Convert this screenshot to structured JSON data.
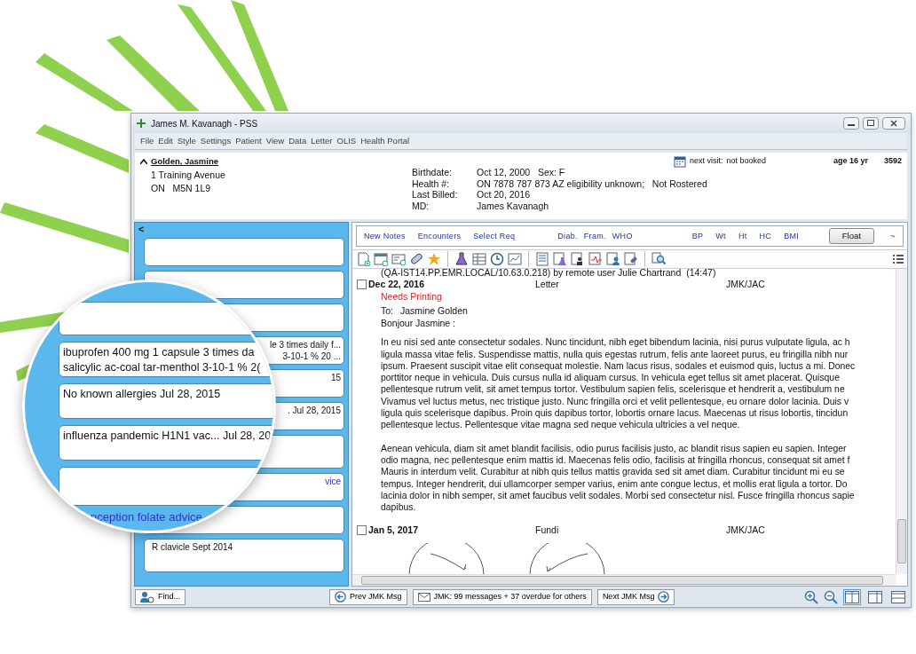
{
  "window": {
    "title": "James M. Kavanagh - PSS"
  },
  "menu": [
    "File",
    "Edit",
    "Style",
    "Settings",
    "Patient",
    "View",
    "Data",
    "Letter",
    "OLIS",
    "Health Portal"
  ],
  "patient": {
    "name": "Golden, Jasmine",
    "address": [
      "1 Training Avenue",
      "ON   M5N 1L9"
    ],
    "fields": [
      {
        "label": "Birthdate:",
        "value": "Oct 12, 2000   Sex: F"
      },
      {
        "label": "Health #:",
        "value": "ON 7878 787 873 AZ eligibility unknown;   Not Rostered"
      },
      {
        "label": "Last Billed:",
        "value": "Oct 20, 2016"
      },
      {
        "label": "MD:",
        "value": "James Kavanagh"
      }
    ],
    "next_visit_label": "next visit:",
    "next_visit": "not booked",
    "age": "age 16 yr",
    "chart_number": "3592"
  },
  "quick_links": [
    "New Notes",
    "Encounters",
    "Select Req",
    "Diab.",
    "Fram.",
    "WHO",
    "BP",
    "Wt",
    "Ht",
    "HC",
    "BMI"
  ],
  "float_button": "Float",
  "trend_symbol": "~",
  "sidebar": {
    "collapse": "<",
    "cards": [
      {
        "kind": "empty"
      },
      {
        "kind": "empty"
      },
      {
        "kind": "empty"
      },
      {
        "kind": "text",
        "lines": [
          "le 3 times daily f...",
          "3-10-1 % 20 ..."
        ]
      },
      {
        "kind": "text",
        "lines": [
          "15"
        ]
      },
      {
        "kind": "text",
        "lines": [
          ". Jul 28, 2015"
        ]
      },
      {
        "kind": "empty"
      },
      {
        "kind": "link",
        "lines": [
          "vice"
        ]
      },
      {
        "kind": "empty"
      },
      {
        "kind": "text",
        "lines": [
          "R clavicle Sept 2014"
        ]
      }
    ]
  },
  "magnifier": {
    "cards": [
      {
        "kind": "empty"
      },
      {
        "kind": "text",
        "lines": [
          "ibuprofen 400 mg 1 capsule 3 times da",
          "salicylic ac-coal tar-menthol 3-10-1 % 2("
        ]
      },
      {
        "kind": "text",
        "lines": [
          "No known allergies Jul 28, 2015"
        ]
      },
      {
        "kind": "text",
        "lines": [
          "influenza pandemic H1N1 vac... Jul 28, 20"
        ]
      },
      {
        "kind": "empty"
      },
      {
        "kind": "link",
        "lines": [
          "nception folate advice"
        ]
      }
    ]
  },
  "notes": {
    "top_line": "(QA-IST14.PP.EMR.LOCAL/10.63.0.218) by remote user Julie Chartrand  (14:47)",
    "entries": [
      {
        "kind": "letter",
        "checked": false,
        "date": "Dec 22, 2016",
        "type": "Letter",
        "author": "JMK/JAC",
        "status": "Needs Printing",
        "to_label": "To:",
        "to": "Jasmine Golden",
        "greeting": "Bonjour Jasmine :",
        "paragraphs": [
          [
            "In eu nisi sed ante consectetur sodales. Nunc tincidunt, nibh eget bibendum lacinia, nisi purus vulputate ligula, ac h",
            "ligula massa vitae felis. Suspendisse mattis, nulla quis egestas rutrum, felis ante laoreet purus, eu fringilla nibh nur",
            "ipsum. Praesent suscipit vitae elit consequat molestie. Nam lacus risus, sodales et euismod quis, luctus a mi. Donec",
            "porttitor neque in vehicula. Duis cursus nulla id aliquam cursus. In vehicula eget tellus sit amet placerat. Quisque",
            "pellentesque rutrum velit, sit amet tempus tortor. Vestibulum sapien felis, scelerisque et hendrerit a, vestibulum ne",
            "Vivamus vel luctus metus, nec tristique justo. Nunc fringilla orci et velit pellentesque, eu ornare dolor lacinia. Duis v",
            "ligula quis scelerisque dapibus. Proin quis dapibus tortor, lobortis ornare lacus. Maecenas ut risus lobortis, tincidun",
            "pellentesque lectus. Pellentesque vitae magna sed neque vehicula ultricies a vel neque."
          ],
          [
            "Aenean vehicula, diam sit amet blandit facilisis, odio purus facilisis justo, ac blandit risus sapien eu sapien. Integer",
            "odio magna, nec pellentesque enim mattis id. Maecenas felis odio, facilisis at fringilla rhoncus, consequat sit amet f",
            "Mauris in interdum velit. Curabitur at nibh quis tellus mattis gravida sed sit amet diam. Curabitur tincidunt mi eu se",
            "tempus. Integer hendrerit, dui ullamcorper semper varius, enim ante congue lectus, et mollis erat ligula a tortor. Do",
            "lacinia dolor in nibh semper, sit amet faucibus velit sodales. Morbi sed consectetur nisl. Fusce fringilla rhoncus sapie",
            "dapibus."
          ]
        ]
      },
      {
        "kind": "fundi",
        "checked": false,
        "date": "Jan 5, 2017",
        "type": "Fundi",
        "author": "JMK/JAC"
      }
    ]
  },
  "bottom": {
    "find": "Find...",
    "prev": "Prev JMK Msg",
    "messages": "JMK: 99 messages + 37 overdue for others",
    "next": "Next JMK Msg",
    "layouts": [
      {
        "selected": true
      },
      {
        "selected": false
      },
      {
        "selected": false
      }
    ]
  }
}
